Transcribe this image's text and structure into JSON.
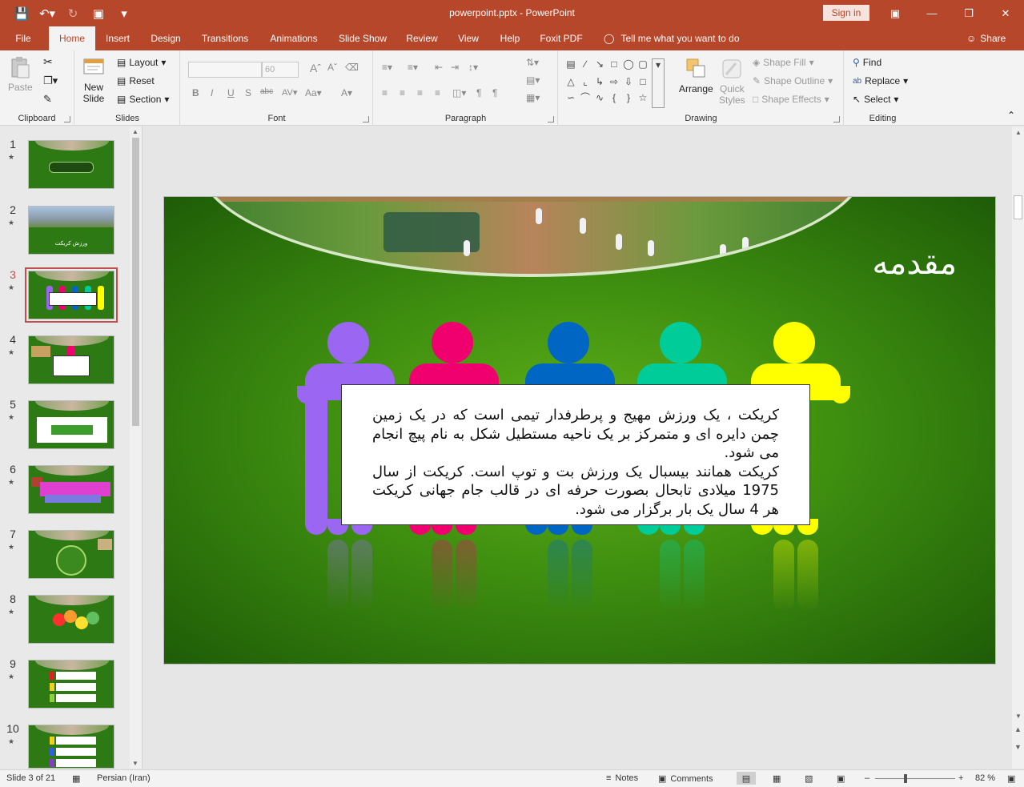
{
  "titlebar": {
    "title": "powerpoint.pptx  -  PowerPoint",
    "sign_in": "Sign in"
  },
  "tabs": [
    {
      "label": "File"
    },
    {
      "label": "Home"
    },
    {
      "label": "Insert"
    },
    {
      "label": "Design"
    },
    {
      "label": "Transitions"
    },
    {
      "label": "Animations"
    },
    {
      "label": "Slide Show"
    },
    {
      "label": "Review"
    },
    {
      "label": "View"
    },
    {
      "label": "Help"
    },
    {
      "label": "Foxit PDF"
    }
  ],
  "tell_me": "Tell me what you want to do",
  "share": "Share",
  "ribbon": {
    "clipboard": {
      "label": "Clipboard",
      "paste": "Paste"
    },
    "slides": {
      "label": "Slides",
      "new_slide_1": "New",
      "new_slide_2": "Slide",
      "layout": "Layout",
      "reset": "Reset",
      "section": "Section"
    },
    "font": {
      "label": "Font",
      "size": "60"
    },
    "paragraph": {
      "label": "Paragraph"
    },
    "drawing": {
      "label": "Drawing",
      "arrange": "Arrange",
      "quick_1": "Quick",
      "quick_2": "Styles",
      "shape_fill": "Shape Fill",
      "shape_outline": "Shape Outline",
      "shape_effects": "Shape Effects"
    },
    "editing": {
      "label": "Editing",
      "find": "Find",
      "replace": "Replace",
      "select": "Select"
    }
  },
  "thumbnails": [
    {
      "num": "1",
      "label": ""
    },
    {
      "num": "2",
      "label": "ورزش کریکت"
    },
    {
      "num": "3",
      "label": ""
    },
    {
      "num": "4",
      "label": ""
    },
    {
      "num": "5",
      "label": ""
    },
    {
      "num": "6",
      "label": ""
    },
    {
      "num": "7",
      "label": ""
    },
    {
      "num": "8",
      "label": ""
    },
    {
      "num": "9",
      "label": ""
    },
    {
      "num": "10",
      "label": ""
    }
  ],
  "active_slide": 3,
  "slide": {
    "title": "مقدمه",
    "paragraph_1": "کریکت ، یک ورزش مهیج و پرطرفدار تیمی است که در یک زمین چمن دایره ای و متمرکز بر یک ناحیه مستطیل شکل به نام پیچ انجام می شود.",
    "paragraph_2": "کریکت همانند بیسبال یک ورزش بت و توپ است. کریکت از سال 1975 میلادی تابحال بصورت حرفه ای در قالب جام جهانی کریکت هر 4 سال یک بار برگزار می شود.",
    "figure_colors": [
      "#9b66f2",
      "#f0006e",
      "#0066c4",
      "#00cc99",
      "#ffff00"
    ]
  },
  "status": {
    "slide_of": "Slide 3 of 21",
    "language": "Persian (Iran)",
    "notes": "Notes",
    "comments": "Comments",
    "zoom": "82 %"
  },
  "colors": {
    "accent": "#b7472a"
  }
}
